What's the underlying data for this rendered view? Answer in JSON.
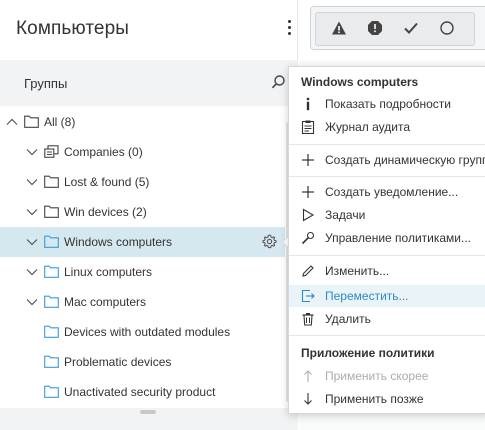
{
  "header": {
    "title": "Компьютеры"
  },
  "groups": {
    "label": "Группы"
  },
  "tree": [
    {
      "label": "All (8)",
      "chev": "up",
      "icon": "folder"
    },
    {
      "label": "Companies (0)",
      "chev": "down",
      "icon": "companies"
    },
    {
      "label": "Lost & found (5)",
      "chev": "down",
      "icon": "folder"
    },
    {
      "label": "Win devices (2)",
      "chev": "down",
      "icon": "folder"
    },
    {
      "label": "Windows computers",
      "chev": "down",
      "icon": "folder-blue",
      "selected": true
    },
    {
      "label": "Linux computers",
      "chev": "down",
      "icon": "folder-blue"
    },
    {
      "label": "Mac computers",
      "chev": "down",
      "icon": "folder-blue"
    },
    {
      "label": "Devices with outdated modules",
      "chev": "none",
      "icon": "folder-blue"
    },
    {
      "label": "Problematic devices",
      "chev": "none",
      "icon": "folder-blue"
    },
    {
      "label": "Unactivated security product",
      "chev": "none",
      "icon": "folder-blue"
    }
  ],
  "menu": {
    "title": "Windows computers",
    "items": [
      {
        "label": "Показать подробности",
        "icon": "info-icon"
      },
      {
        "label": "Журнал аудита",
        "icon": "audit-log-icon"
      },
      {
        "label": "Создать динамическую группу",
        "icon": "plus-icon"
      },
      {
        "label": "Создать уведомление...",
        "icon": "plus-icon"
      },
      {
        "label": "Задачи",
        "icon": "play-icon"
      },
      {
        "label": "Управление политиками...",
        "icon": "wrench-icon"
      },
      {
        "label": "Изменить...",
        "icon": "pencil-icon"
      },
      {
        "label": "Переместить...",
        "icon": "move-icon",
        "highlighted": true
      },
      {
        "label": "Удалить",
        "icon": "trash-icon"
      }
    ],
    "section2_title": "Приложение политики",
    "section2_items": [
      {
        "label": "Применить скорее",
        "icon": "arrow-up-icon",
        "disabled": true
      },
      {
        "label": "Применить позже",
        "icon": "arrow-down-icon"
      }
    ]
  },
  "colors": {
    "accent": "#2e8bc9",
    "selected_row": "#d5e8f0",
    "folder_blue": "#3a9bd9"
  }
}
